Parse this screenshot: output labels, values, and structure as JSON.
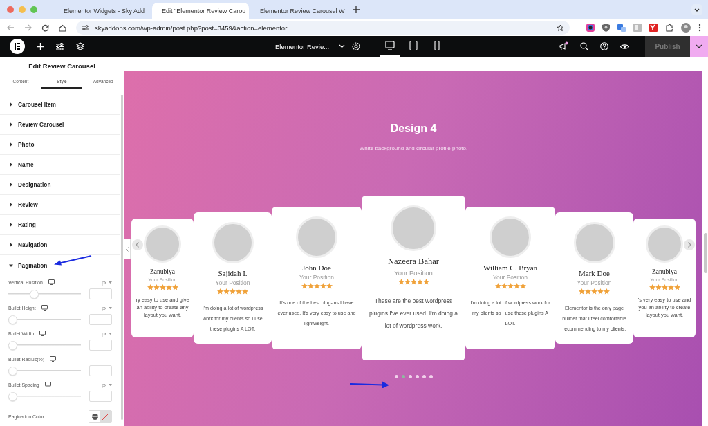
{
  "browser": {
    "tabs": [
      {
        "title": "Elementor Widgets - Sky Add",
        "selected": false
      },
      {
        "title": "Edit \"Elementor Review Carou",
        "selected": true
      },
      {
        "title": "Elementor Review Carousel W",
        "selected": false
      }
    ],
    "url": "skyaddons.com/wp-admin/post.php?post=3459&action=elementor"
  },
  "topbar": {
    "page_title": "Elementor Revie...",
    "devices": [
      {
        "kind": "desktop",
        "selected": true
      },
      {
        "kind": "tablet",
        "selected": false
      },
      {
        "kind": "mobile",
        "selected": false
      }
    ],
    "publish": {
      "label": "Publish",
      "disabled": true
    }
  },
  "panel": {
    "title": "Edit Review Carousel",
    "tabs": [
      {
        "label": "Content",
        "selected": false
      },
      {
        "label": "Style",
        "selected": true
      },
      {
        "label": "Advanced",
        "selected": false
      }
    ],
    "sections": [
      {
        "label": "Carousel Item",
        "expanded": false
      },
      {
        "label": "Review Carousel",
        "expanded": false
      },
      {
        "label": "Photo",
        "expanded": false
      },
      {
        "label": "Name",
        "expanded": false
      },
      {
        "label": "Designation",
        "expanded": false
      },
      {
        "label": "Review",
        "expanded": false
      },
      {
        "label": "Rating",
        "expanded": false
      },
      {
        "label": "Navigation",
        "expanded": false
      },
      {
        "label": "Pagination",
        "expanded": true
      }
    ],
    "controls": [
      {
        "kind": "slider",
        "label": "Vertical Position",
        "unit": "px",
        "level": 0.34
      },
      {
        "kind": "slider",
        "label": "Bullet Height",
        "unit": "px",
        "level": 0
      },
      {
        "kind": "slider",
        "label": "Bullet Width",
        "unit": "px",
        "level": 0
      },
      {
        "kind": "slider",
        "label": "Bullet Radius(%)",
        "level": 0
      },
      {
        "kind": "slider",
        "label": "Bullet Spacing",
        "unit": "px",
        "level": 0
      },
      {
        "kind": "color",
        "label": "Pagination Color"
      }
    ]
  },
  "canvas": {
    "heading": "Design 4",
    "subheading": "White background and circular profile photo.",
    "cards": [
      {
        "name": "Zanubiya",
        "position": "Your Position",
        "stars": 5,
        "review": "ry easy to use and give an ability to create any layout you want.",
        "active": false
      },
      {
        "name": "Sajidah I.",
        "position": "Your Position",
        "stars": 5,
        "review": "I'm doing a lot of wordpress work for my clients so I use these plugins A LOT.",
        "active": false
      },
      {
        "name": "John Doe",
        "position": "Your Position",
        "stars": 5,
        "review": "It's one of the best plug-ins I have ever used. It's very easy to use and lightweight.",
        "active": false
      },
      {
        "name": "Nazeera Bahar",
        "position": "Your Position",
        "stars": 5,
        "review": "These are the best wordpress plugins I've ever used. I'm doing a lot of wordpress work.",
        "active": true
      },
      {
        "name": "William C. Bryan",
        "position": "Your Position",
        "stars": 5,
        "review": "I'm doing a lot of wordpress work for my clients so I use these plugins A LOT.",
        "active": false
      },
      {
        "name": "Mark Doe",
        "position": "Your Position",
        "stars": 5,
        "review": "Elementor is the only page builder that I feel comfortable recommending to my clients.",
        "active": false
      },
      {
        "name": "Zanubiya",
        "position": "Your Position",
        "stars": 5,
        "review": "'s very easy to use and you an ability to create layout you want.",
        "active": false
      }
    ],
    "dots": [
      {
        "selected": false
      },
      {
        "selected": true
      },
      {
        "selected": false
      },
      {
        "selected": false
      },
      {
        "selected": false
      },
      {
        "selected": false
      }
    ]
  }
}
